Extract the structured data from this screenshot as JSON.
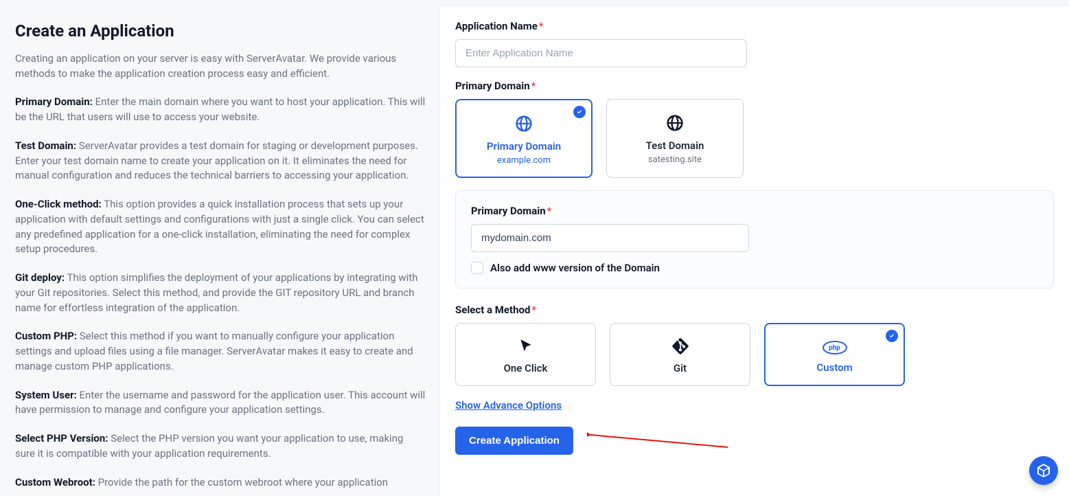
{
  "left": {
    "title": "Create an Application",
    "intro": "Creating an application on your server is easy with ServerAvatar. We provide various methods to make the application creation process easy and efficient.",
    "items": [
      {
        "label": "Primary Domain:",
        "text": " Enter the main domain where you want to host your application. This will be the URL that users will use to access your website."
      },
      {
        "label": "Test Domain:",
        "text": " ServerAvatar provides a test domain for staging or development purposes. Enter your test domain name to create your application on it. It eliminates the need for manual configuration and reduces the technical barriers to accessing your application."
      },
      {
        "label": "One-Click method:",
        "text": " This option provides a quick installation process that sets up your application with default settings and configurations with just a single click. You can select any predefined application for a one-click installation, eliminating the need for complex setup procedures."
      },
      {
        "label": "Git deploy:",
        "text": " This option simplifies the deployment of your applications by integrating with your Git repositories. Select this method, and provide the GIT repository URL and branch name for effortless integration of the application."
      },
      {
        "label": "Custom PHP:",
        "text": " Select this method if you want to manually configure your application settings and upload files using a file manager. ServerAvatar makes it easy to create and manage custom PHP applications."
      },
      {
        "label": "System User:",
        "text": " Enter the username and password for the application user. This account will have permission to manage and configure your application settings."
      },
      {
        "label": "Select PHP Version:",
        "text": " Select the PHP version you want your application to use, making sure it is compatible with your application requirements."
      },
      {
        "label": "Custom Webroot:",
        "text": " Provide the path for the custom webroot where your application"
      }
    ]
  },
  "form": {
    "app_name_label": "Application Name",
    "app_name_placeholder": "Enter Application Name",
    "primary_domain_label": "Primary Domain",
    "domain_options": [
      {
        "title": "Primary Domain",
        "sub": "example.com"
      },
      {
        "title": "Test Domain",
        "sub": "satesting.site"
      }
    ],
    "sub_primary_label": "Primary Domain",
    "sub_primary_value": "mydomain.com",
    "www_checkbox": "Also add www version of the Domain",
    "method_label": "Select a Method",
    "methods": [
      {
        "title": "One Click"
      },
      {
        "title": "Git"
      },
      {
        "title": "Custom",
        "php": "php"
      }
    ],
    "advance_link": "Show Advance Options",
    "submit": "Create Application"
  }
}
